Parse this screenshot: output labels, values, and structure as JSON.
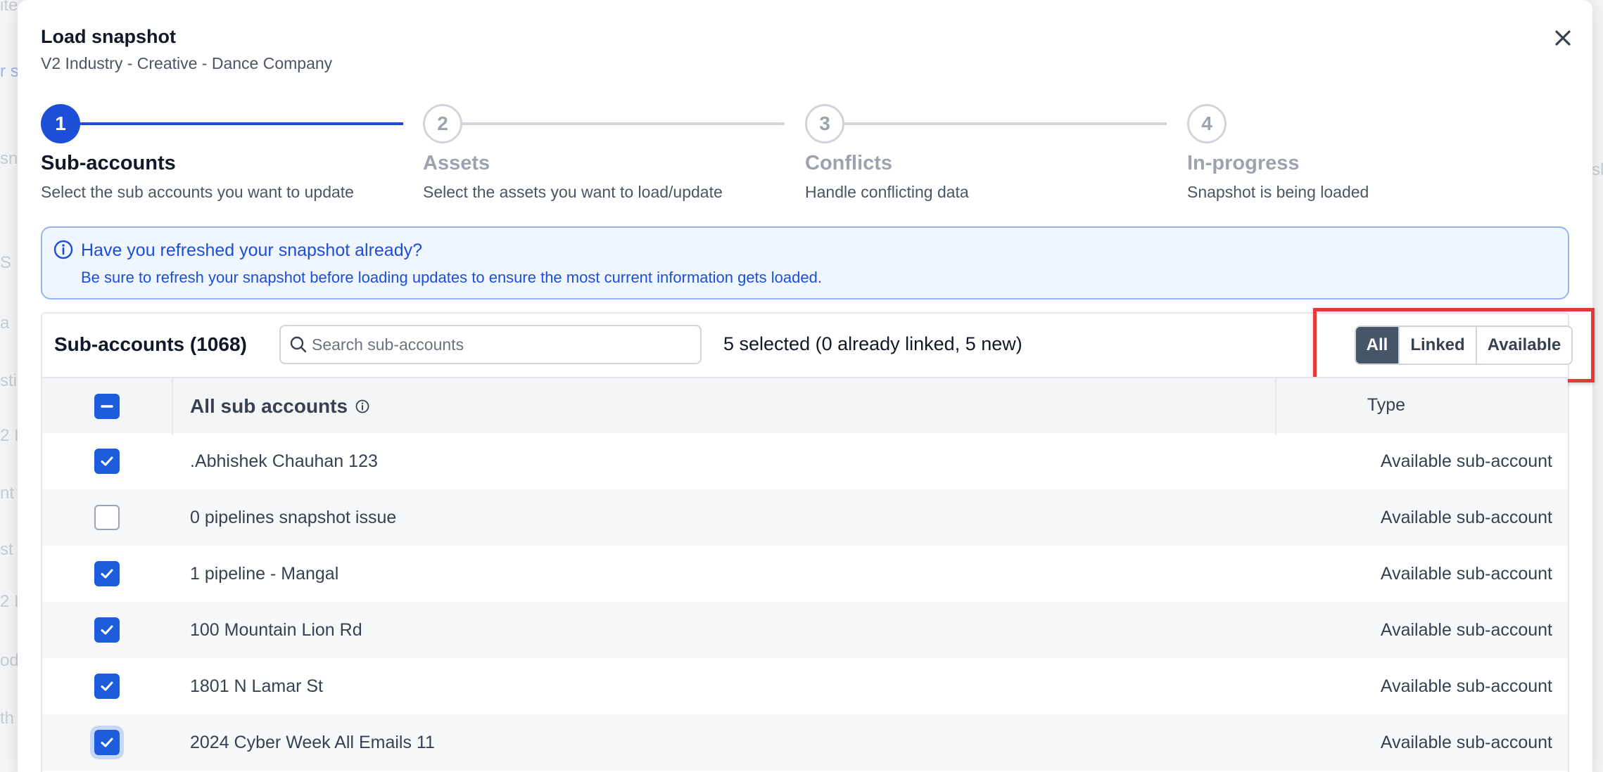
{
  "modal": {
    "title": "Load snapshot",
    "subtitle": "V2 Industry - Creative - Dance Company"
  },
  "steps": [
    {
      "number": "1",
      "title": "Sub-accounts",
      "description": "Select the sub accounts you want to update",
      "state": "active"
    },
    {
      "number": "2",
      "title": "Assets",
      "description": "Select the assets you want to load/update",
      "state": "inactive"
    },
    {
      "number": "3",
      "title": "Conflicts",
      "description": "Handle conflicting data",
      "state": "inactive"
    },
    {
      "number": "4",
      "title": "In-progress",
      "description": "Snapshot is being loaded",
      "state": "inactive"
    }
  ],
  "banner": {
    "title": "Have you refreshed your snapshot already?",
    "text": "Be sure to refresh your snapshot before loading updates to ensure the most current information gets loaded."
  },
  "table": {
    "title": "Sub-accounts (1068)",
    "search_placeholder": "Search sub-accounts",
    "selected_info": "5 selected (0 already linked, 5 new)",
    "filters": [
      "All",
      "Linked",
      "Available"
    ],
    "active_filter": "All",
    "header_name": "All sub accounts",
    "header_type": "Type",
    "rows": [
      {
        "name": ".Abhishek Chauhan 123",
        "type": "Available sub-account",
        "checked": true
      },
      {
        "name": "0 pipelines snapshot issue",
        "type": "Available sub-account",
        "checked": false
      },
      {
        "name": "1 pipeline - Mangal",
        "type": "Available sub-account",
        "checked": true
      },
      {
        "name": "100 Mountain Lion Rd",
        "type": "Available sub-account",
        "checked": true
      },
      {
        "name": "1801 N Lamar St",
        "type": "Available sub-account",
        "checked": true
      },
      {
        "name": "2024 Cyber Week All Emails 11",
        "type": "Available sub-account",
        "checked": true
      }
    ]
  },
  "colors": {
    "primary": "#1d4ed8",
    "highlight": "#e53935",
    "active_filter": "#475569"
  }
}
